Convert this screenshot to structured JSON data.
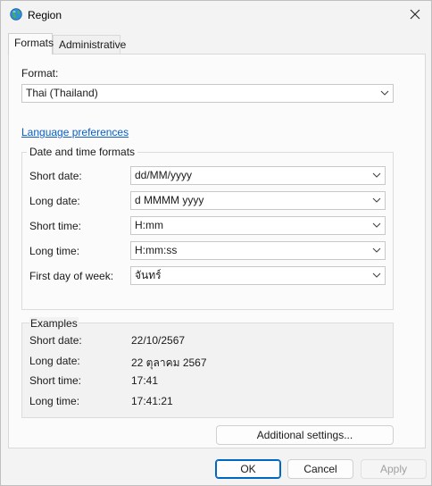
{
  "window": {
    "title": "Region"
  },
  "tabs": [
    {
      "label": "Formats",
      "active": true
    },
    {
      "label": "Administrative",
      "active": false
    }
  ],
  "format": {
    "label": "Format:",
    "value": "Thai (Thailand)"
  },
  "language_preferences_link": "Language preferences",
  "date_time_formats": {
    "title": "Date and time formats",
    "rows": [
      {
        "label": "Short date:",
        "value": "dd/MM/yyyy"
      },
      {
        "label": "Long date:",
        "value": "d MMMM yyyy"
      },
      {
        "label": "Short time:",
        "value": "H:mm"
      },
      {
        "label": "Long time:",
        "value": "H:mm:ss"
      },
      {
        "label": "First day of week:",
        "value": "จันทร์"
      }
    ]
  },
  "examples": {
    "title": "Examples",
    "rows": [
      {
        "label": "Short date:",
        "value": "22/10/2567"
      },
      {
        "label": "Long date:",
        "value": "22 ตุลาคม 2567"
      },
      {
        "label": "Short time:",
        "value": "17:41"
      },
      {
        "label": "Long time:",
        "value": "17:41:21"
      }
    ]
  },
  "buttons": {
    "additional_settings": "Additional settings...",
    "ok": "OK",
    "cancel": "Cancel",
    "apply": "Apply"
  },
  "colors": {
    "link": "#0a5ec6",
    "primary_border": "#0067c0",
    "window_bg": "#f3f3f3",
    "panel_bg": "#fbfbfb"
  },
  "icons": {
    "app": "globe-icon",
    "close": "close-icon",
    "dropdown": "chevron-down-icon"
  }
}
